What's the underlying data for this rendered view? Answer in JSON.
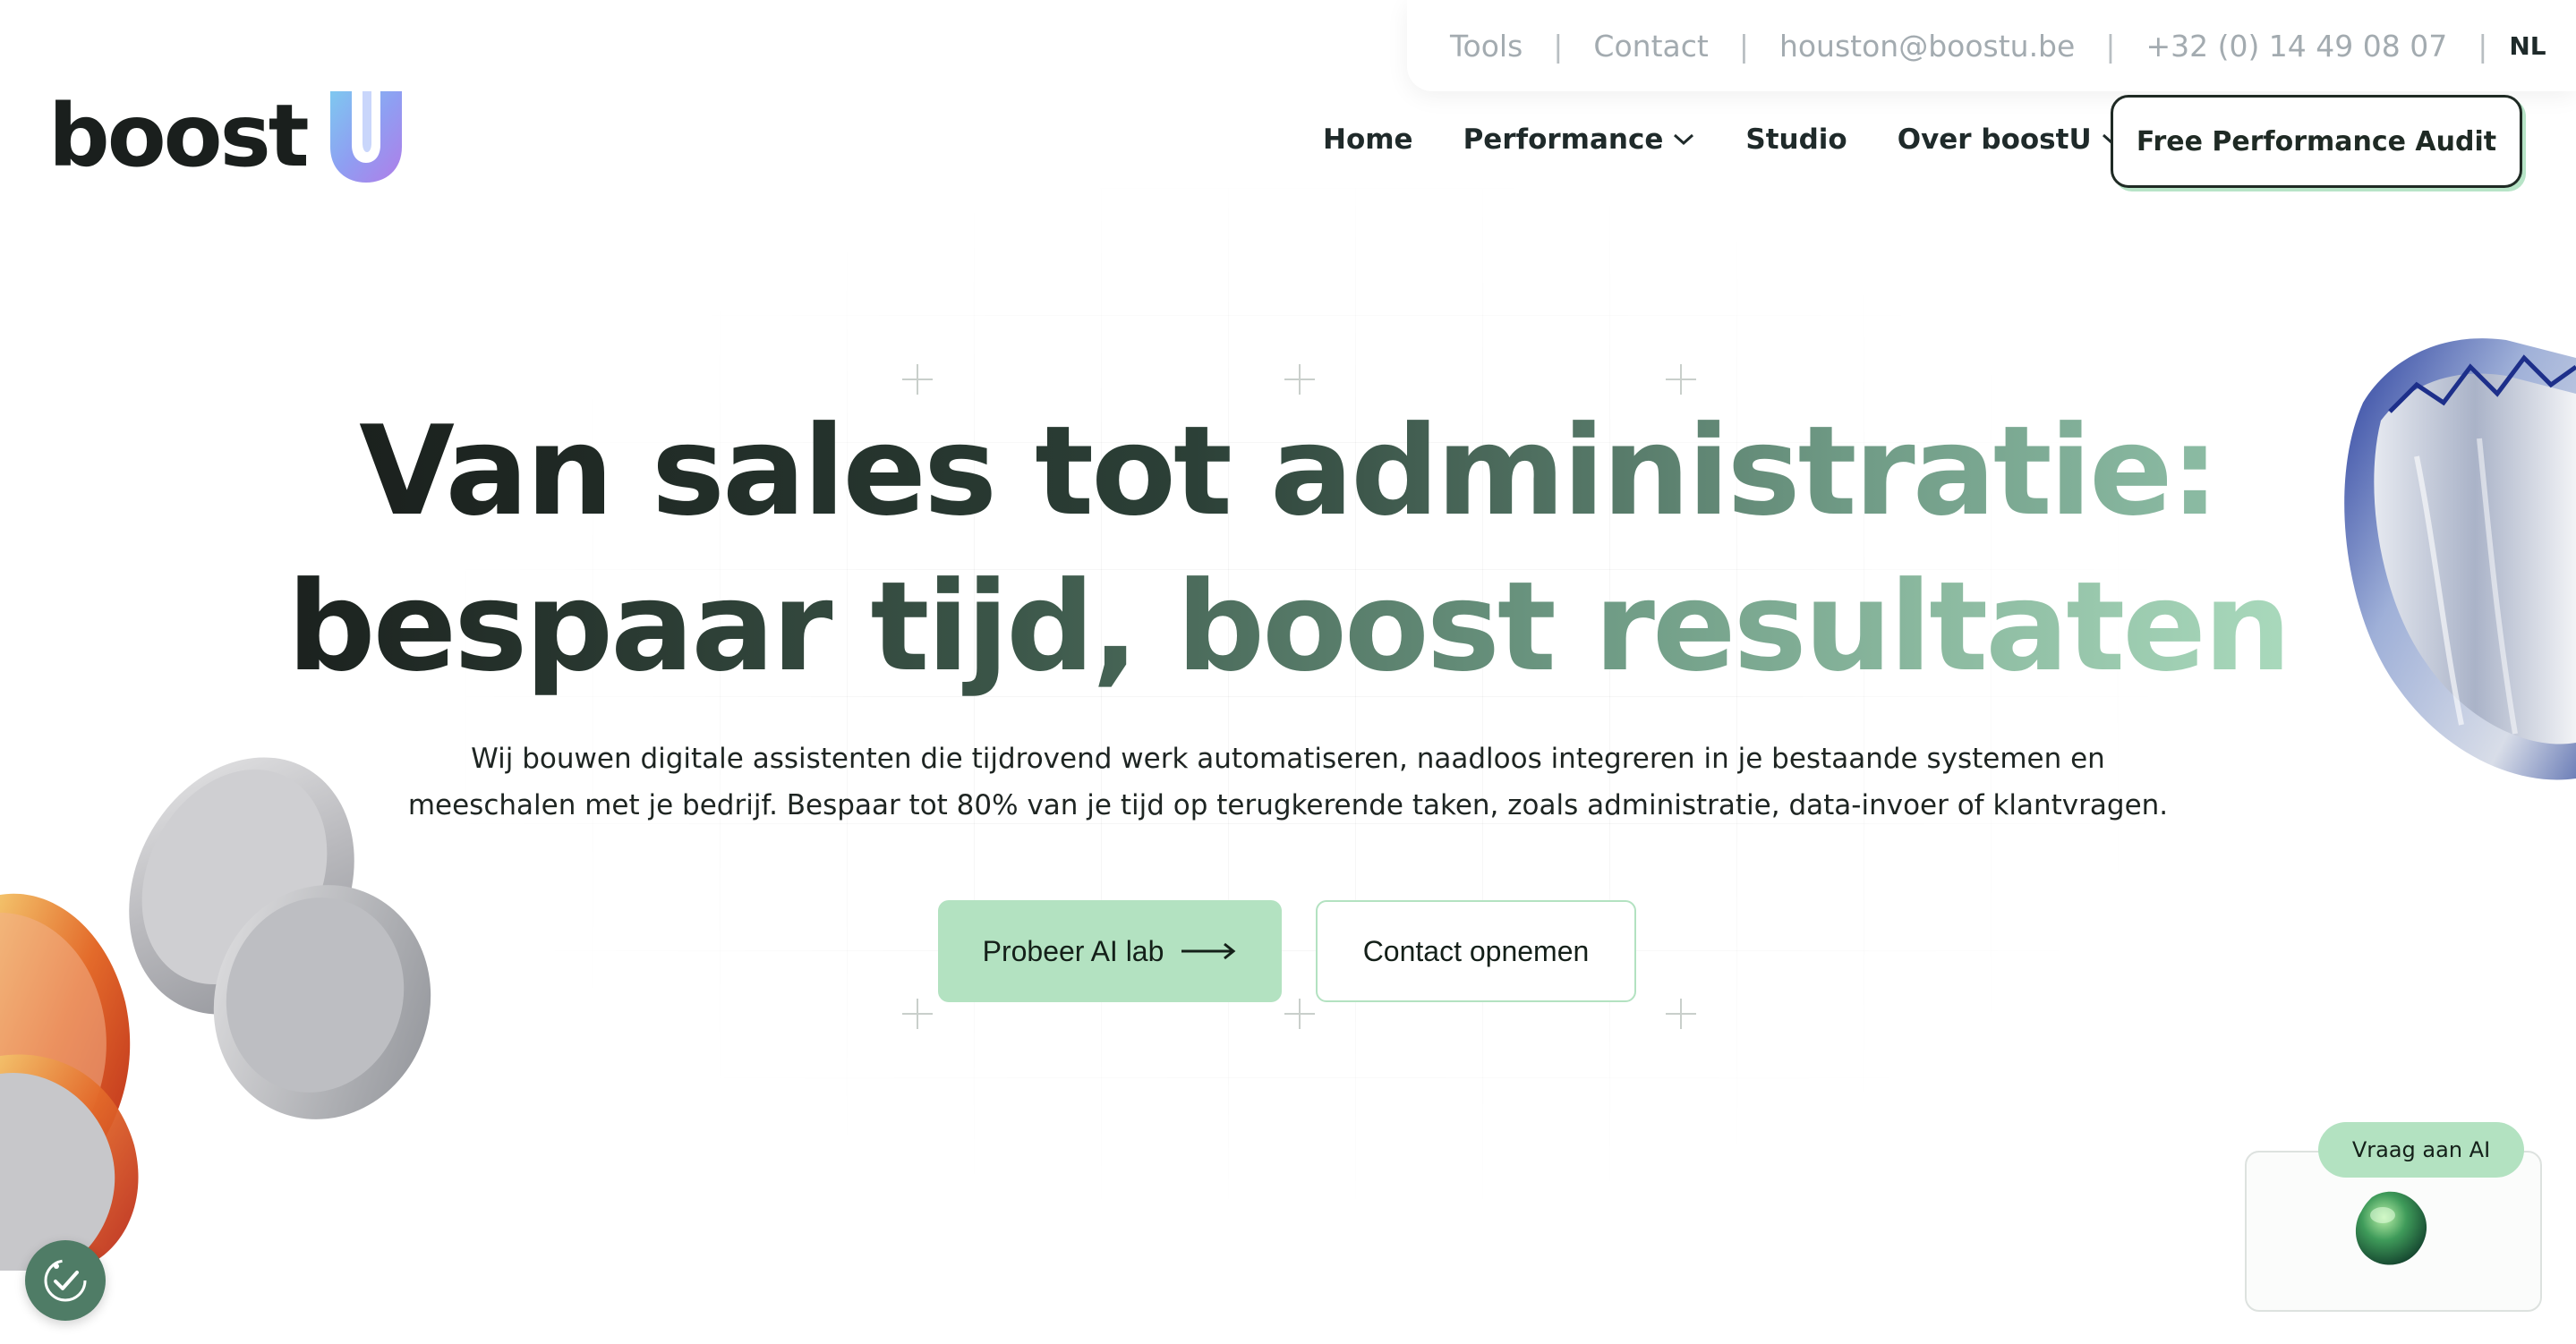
{
  "topbar": {
    "tools": "Tools",
    "contact": "Contact",
    "email": "houston@boostu.be",
    "phone": "+32 (0) 14 49 08 07",
    "separator": "|",
    "language": "NL"
  },
  "logo": {
    "text": "boost"
  },
  "nav": {
    "home": "Home",
    "performance": "Performance",
    "studio": "Studio",
    "over": "Over boostU",
    "cta": "Free Performance Audit"
  },
  "hero": {
    "line1_a": "Van sales tot administratie:",
    "line2_a": "bespaar tijd,",
    "line2_b": "boost resultaten",
    "subtitle_1": "Wij bouwen digitale assistenten die tijdrovend werk automatiseren, naadloos integreren in je bestaande systemen en",
    "subtitle_2": "meeschalen met je bedrijf. Bespaar tot 80% van je tijd op terugkerende taken, zoals administratie, data-invoer of klantvragen.",
    "primary_button": "Probeer AI lab",
    "secondary_button": "Contact opnemen"
  },
  "widgets": {
    "ai_label": "Vraag aan AI"
  },
  "colors": {
    "accent_green": "#b3e2c1",
    "dark_text": "#1f2a24",
    "muted_text": "#a3abb0",
    "access_button": "#4f7c66"
  },
  "icons": {
    "nav_dropdown": "chevron-down-icon",
    "button_arrow": "arrow-right-icon",
    "accessibility": "accessibility-check-icon",
    "ai_avatar": "ai-blob-icon",
    "logo_mark": "boostu-u-logo-icon"
  }
}
